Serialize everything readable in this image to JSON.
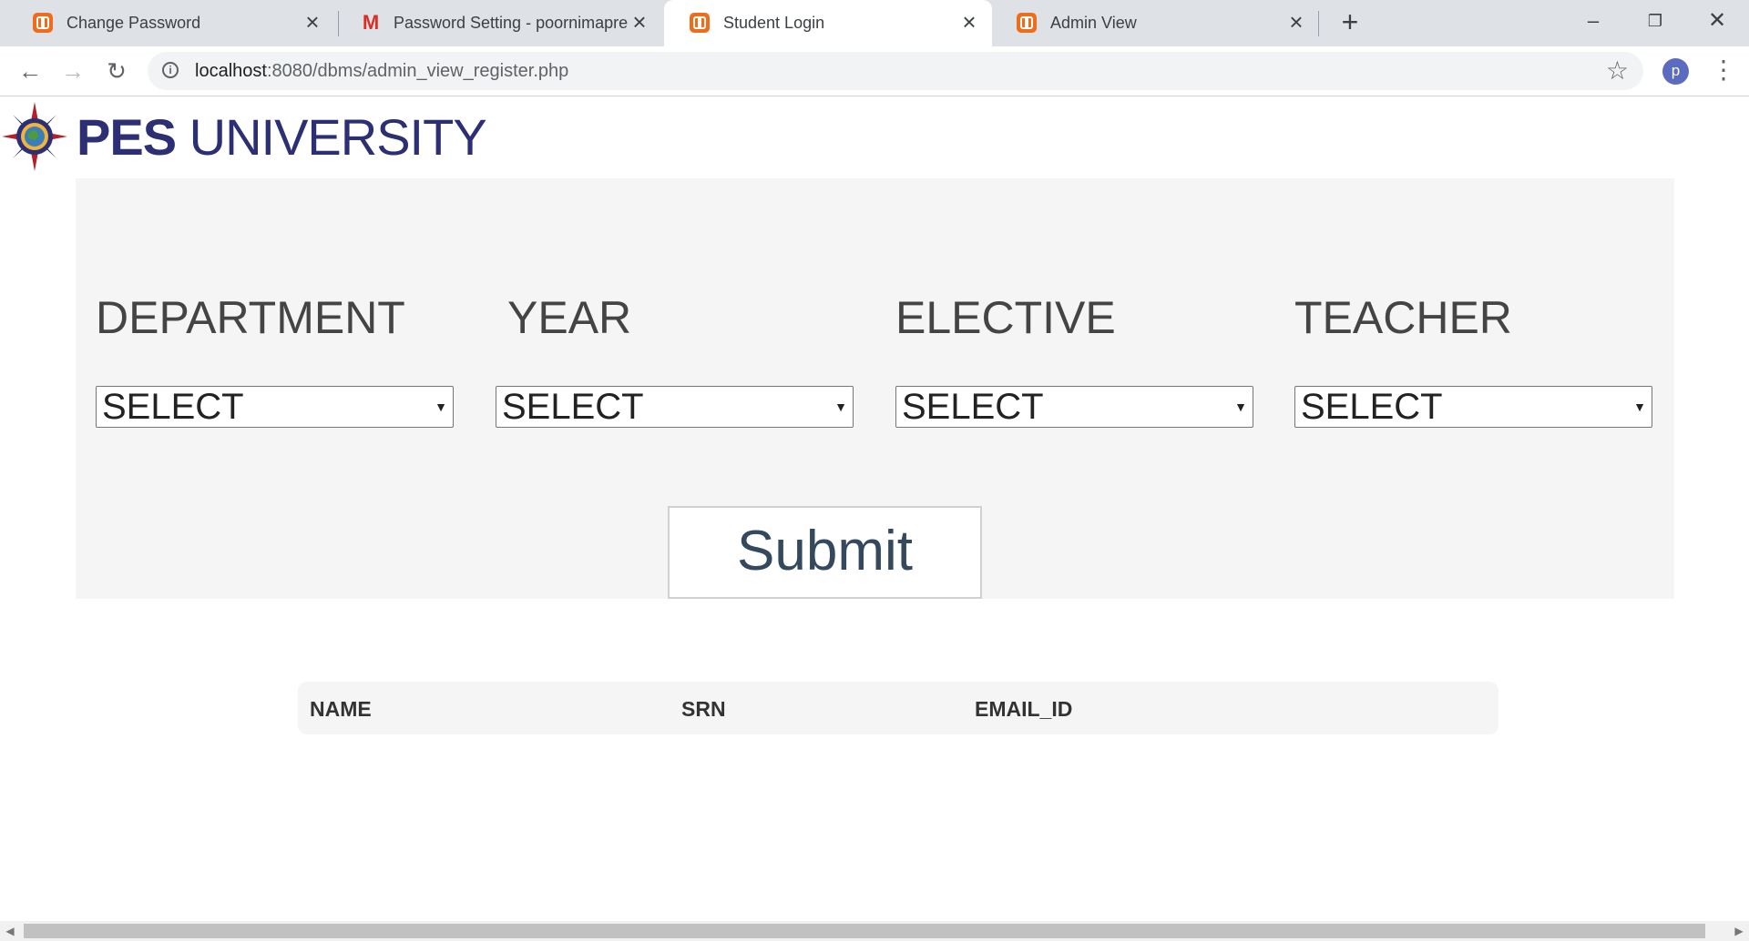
{
  "browser": {
    "tabs": [
      {
        "title": "Change Password",
        "icon": "xampp-icon",
        "active": false
      },
      {
        "title": "Password Setting - poornimapre",
        "icon": "gmail-icon",
        "active": false
      },
      {
        "title": "Student Login",
        "icon": "xampp-icon",
        "active": true
      },
      {
        "title": "Admin View",
        "icon": "xampp-icon",
        "active": false
      }
    ],
    "new_tab": "+",
    "url_host": "localhost",
    "url_rest": ":8080/dbms/admin_view_register.php",
    "profile_initial": "p"
  },
  "page": {
    "logo": {
      "bold": "PES",
      "rest": " UNIVERSITY"
    },
    "filters": [
      {
        "label": "DEPARTMENT",
        "value": "SELECT"
      },
      {
        "label": "YEAR",
        "value": "SELECT"
      },
      {
        "label": "ELECTIVE",
        "value": "SELECT"
      },
      {
        "label": "TEACHER",
        "value": "SELECT"
      }
    ],
    "submit_label": "Submit",
    "table_headers": [
      "NAME",
      "SRN",
      "EMAIL_ID"
    ]
  },
  "colors": {
    "brand": "#2c2f73",
    "panel_bg": "#f5f5f5",
    "submit_text": "#34495e"
  }
}
